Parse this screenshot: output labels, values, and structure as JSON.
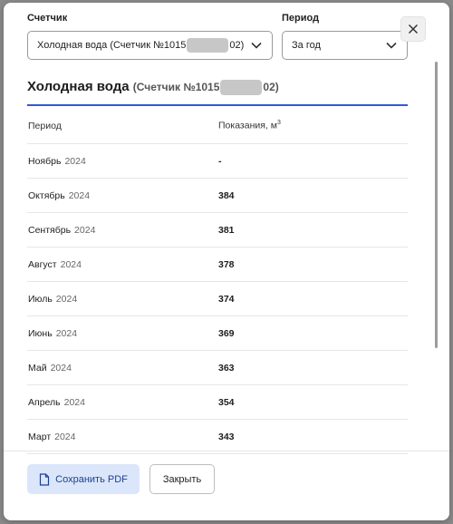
{
  "filters": {
    "meter_label": "Счетчик",
    "meter_value_prefix": "Холодная вода (Счетчик №1015",
    "meter_value_suffix": "02)",
    "period_label": "Период",
    "period_value": "За год"
  },
  "icons": {
    "close": "close-icon",
    "chevron": "chevron-down-icon",
    "pdf": "document-icon"
  },
  "section": {
    "title": "Холодная вода",
    "subtitle_prefix": "(Счетчик №1015",
    "subtitle_suffix": "02)"
  },
  "table": {
    "headers": {
      "period": "Период",
      "readings": "Показания, м",
      "readings_sup": "3"
    },
    "rows": [
      {
        "month": "Ноябрь",
        "year": "2024",
        "value": "-"
      },
      {
        "month": "Октябрь",
        "year": "2024",
        "value": "384"
      },
      {
        "month": "Сентябрь",
        "year": "2024",
        "value": "381"
      },
      {
        "month": "Август",
        "year": "2024",
        "value": "378"
      },
      {
        "month": "Июль",
        "year": "2024",
        "value": "374"
      },
      {
        "month": "Июнь",
        "year": "2024",
        "value": "369"
      },
      {
        "month": "Май",
        "year": "2024",
        "value": "363"
      },
      {
        "month": "Апрель",
        "year": "2024",
        "value": "354"
      },
      {
        "month": "Март",
        "year": "2024",
        "value": "343"
      }
    ]
  },
  "footer": {
    "save_pdf_label": "Сохранить PDF",
    "close_label": "Закрыть"
  },
  "colors": {
    "accent": "#2f5bd3",
    "pdf_button_bg": "#dbe6fb"
  }
}
